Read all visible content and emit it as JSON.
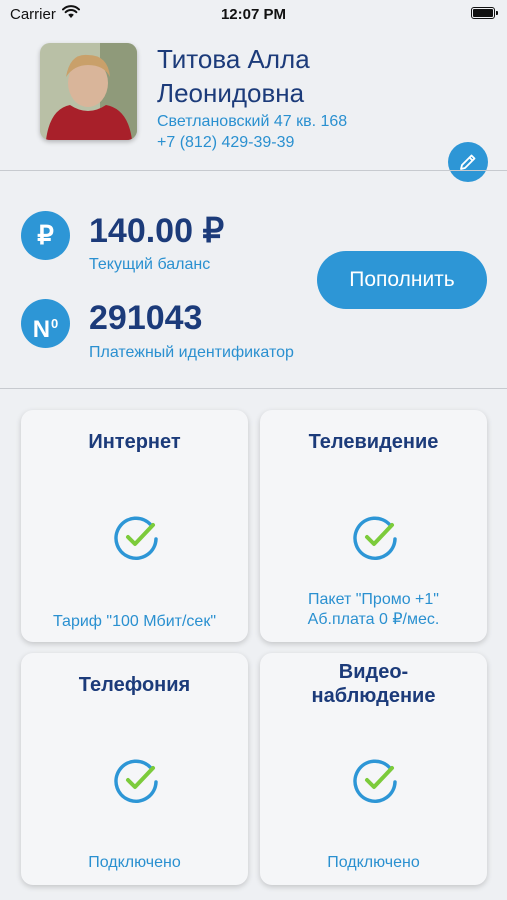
{
  "status_bar": {
    "carrier": "Carrier",
    "time": "12:07 PM"
  },
  "profile": {
    "name_line1": "Титова Алла",
    "name_line2": "Леонидовна",
    "address": "Светлановский 47 кв. 168",
    "phone": "+7 (812) 429-39-39",
    "edit_icon": "pencil-icon"
  },
  "account": {
    "balance_symbol": "₽",
    "balance_value": "140.00 ₽",
    "balance_label": "Текущий баланс",
    "id_symbol": "N",
    "id_symbol_sup": "0",
    "id_value": "291043",
    "id_label": "Платежный идентификатор",
    "topup_label": "Пополнить"
  },
  "services": [
    {
      "title_line1": "Интернет",
      "title_line2": "",
      "status_line1": "Тариф \"100 Мбит/сек\"",
      "status_line2": ""
    },
    {
      "title_line1": "Телевидение",
      "title_line2": "",
      "status_line1": "Пакет \"Промо +1\"",
      "status_line2": "Аб.плата 0 ₽/мес."
    },
    {
      "title_line1": "Телефония",
      "title_line2": "",
      "status_line1": "Подключено",
      "status_line2": ""
    },
    {
      "title_line1": "Видео-",
      "title_line2": "наблюдение",
      "status_line1": "Подключено",
      "status_line2": ""
    }
  ],
  "colors": {
    "accent": "#2d96d6",
    "title": "#1c3b7a",
    "link": "#2a90d0",
    "check_ring": "#2d96d6",
    "check_mark": "#7ccb3b"
  }
}
